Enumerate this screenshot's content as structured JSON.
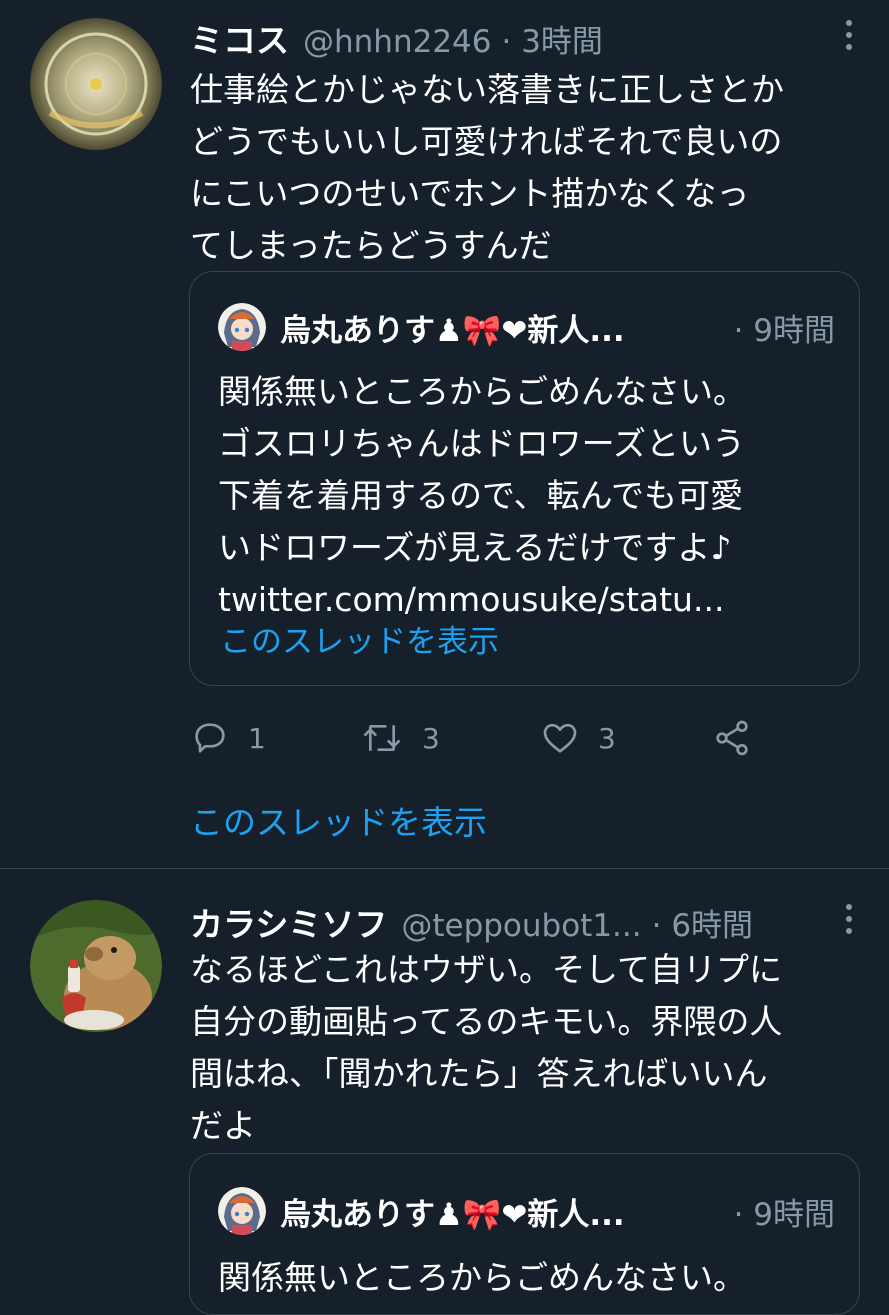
{
  "tweets": [
    {
      "name": "ミコス",
      "handle": "@hnhn2246",
      "time": "· 3時間",
      "text": "仕事絵とかじゃない落書きに正しさとか\nどうでもいいし可愛ければそれで良いの\nにこいつのせいでホント描かなくなっ\nてしまったらどうすんだ",
      "quote": {
        "name": "烏丸ありす♟🎀❤新人...",
        "time": "· 9時間",
        "text": "関係無いところからごめんなさい。\nゴスロリちゃんはドロワーズという\n下着を着用するので、転んでも可愛\nいドロワーズが見えるだけですよ♪",
        "link": "twitter.com/mmousuke/statu...",
        "thread": "このスレッドを表示"
      },
      "actions": {
        "reply_icon": "reply-icon",
        "reply_count": "1",
        "retweet_icon": "retweet-icon",
        "retweet_count": "3",
        "like_icon": "like-icon",
        "like_count": "3",
        "share_icon": "share-icon"
      },
      "thread": "このスレッドを表示"
    },
    {
      "name": "カラシミソフ",
      "handle": "@teppoubot1...",
      "time": "· 6時間",
      "text": "なるほどこれはウザい。そして自リプに\n自分の動画貼ってるのキモい。界隈の人\n間はね、「聞かれたら」答えればいいん\nだよ",
      "quote": {
        "name": "烏丸ありす♟🎀❤新人...",
        "time": "· 9時間",
        "text": "関係無いところからごめんなさい。"
      }
    }
  ],
  "colors": {
    "background": "#15202b",
    "secondary_text": "#8899a6",
    "link": "#1da1f2",
    "border": "#38444d"
  }
}
